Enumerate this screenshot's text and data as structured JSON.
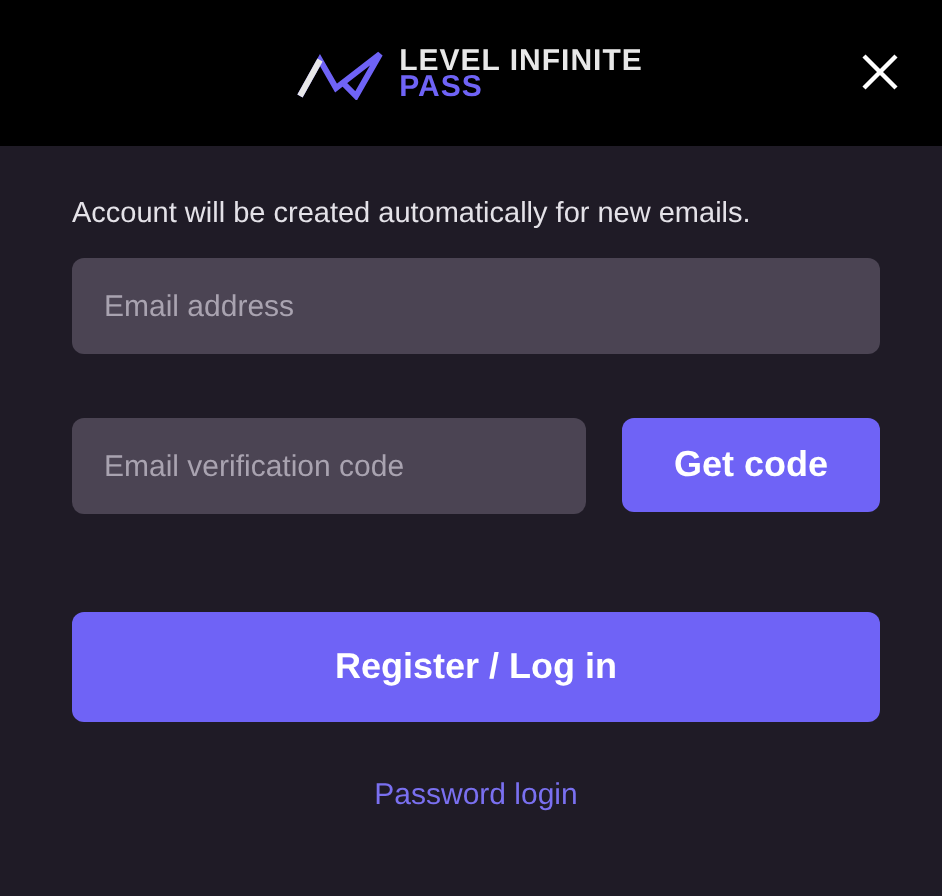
{
  "header": {
    "logo_top": "LEVEL INFINITE",
    "logo_bottom": "PASS"
  },
  "notice": "Account will be created automatically for new emails.",
  "email": {
    "placeholder": "Email address"
  },
  "code": {
    "placeholder": "Email verification code"
  },
  "get_code_button": "Get code",
  "submit_button": "Register / Log in",
  "alt_link": "Password login"
}
